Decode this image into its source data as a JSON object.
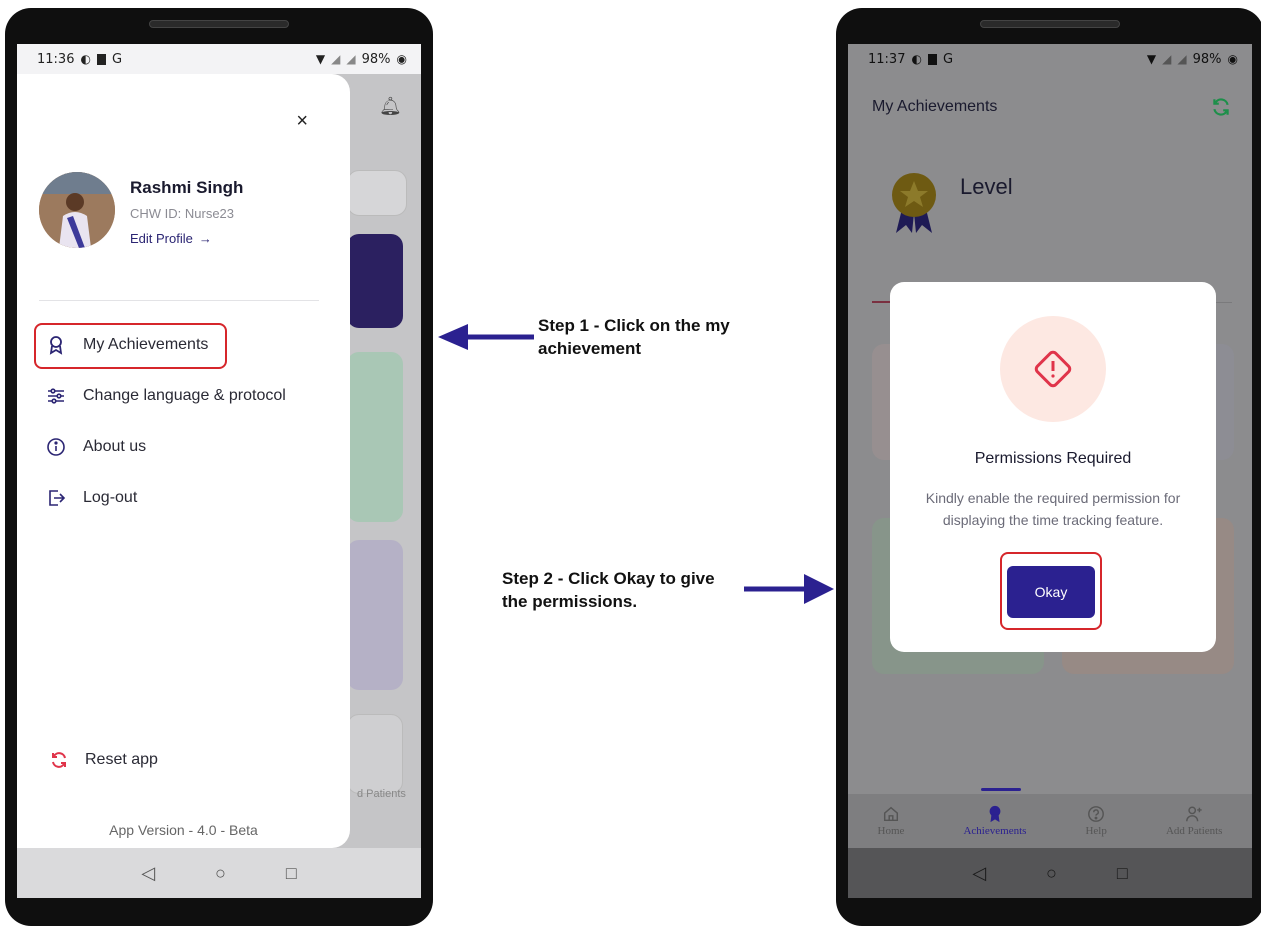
{
  "left_phone": {
    "status": {
      "time": "11:36",
      "carrier": "G",
      "battery": "98%"
    },
    "drawer": {
      "close_label": "×",
      "profile": {
        "name": "Rashmi Singh",
        "id": "CHW ID: Nurse23",
        "edit_label": "Edit Profile",
        "edit_arrow": "→"
      },
      "menu": [
        {
          "label": "My Achievements",
          "icon": "achievement-ribbon-icon"
        },
        {
          "label": "Change language & protocol",
          "icon": "sliders-icon"
        },
        {
          "label": "About us",
          "icon": "info-bubble-icon"
        },
        {
          "label": "Log-out",
          "icon": "logout-icon"
        }
      ],
      "reset_label": "Reset app",
      "app_version": "App Version - 4.0 - Beta"
    },
    "background_peek": {
      "add_patients": "d Patients"
    },
    "nav_buttons": {
      "back": "◁",
      "home": "○",
      "recent": "□"
    }
  },
  "right_phone": {
    "status": {
      "time": "11:37",
      "carrier": "G",
      "battery": "98%"
    },
    "title": "My Achievements",
    "level_label": "Level",
    "dialog": {
      "title": "Permissions Required",
      "message": "Kindly enable the required permission for displaying the time tracking feature.",
      "button_label": "Okay"
    },
    "tabs": [
      {
        "label": "Home",
        "icon": "home-icon"
      },
      {
        "label": "Achievements",
        "icon": "ribbon-icon",
        "active": true
      },
      {
        "label": "Help",
        "icon": "help-icon"
      },
      {
        "label": "Add Patients",
        "icon": "add-user-icon"
      }
    ],
    "nav_buttons": {
      "back": "◁",
      "home": "○",
      "recent": "□"
    }
  },
  "annotations": {
    "step1": "Step 1 - Click on the my achievement",
    "step2": "Step 2 - Click Okay to give the permissions."
  },
  "colors": {
    "accent": "#2b2190",
    "highlight": "#d6262b",
    "alert": "#e0344a",
    "alert_bg": "#fde8e2",
    "success": "#1d8f4a"
  }
}
